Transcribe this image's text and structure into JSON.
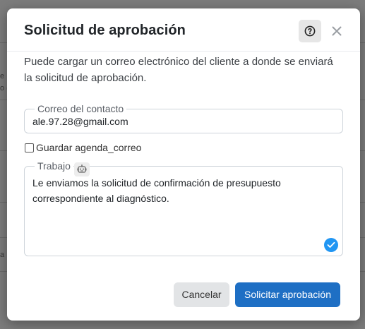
{
  "background": {
    "fragments": [
      "e",
      "o (",
      "a"
    ]
  },
  "modal": {
    "title": "Solicitud de aprobación",
    "help_icon": "question-circle-icon",
    "close_icon": "close-icon",
    "description": "Puede cargar un correo electrónico del cliente a donde se enviará la solicitud de aprobación.",
    "email_field": {
      "label": "Correo del contacto",
      "value": "ale.97.28@gmail.com"
    },
    "save_checkbox": {
      "label": "Guardar agenda_correo",
      "checked": false
    },
    "work_field": {
      "label": "Trabajo",
      "robot_icon": "robot-icon",
      "value": "Le enviamos la solicitud de confirmación de presupuesto correspondiente al diagnóstico.",
      "status_icon": "check-circle-icon"
    },
    "buttons": {
      "cancel": "Cancelar",
      "submit": "Solicitar aprobación"
    }
  },
  "colors": {
    "primary": "#1e6fc4",
    "check_badge": "#2196f3",
    "overlay": "#7c7c7c"
  }
}
